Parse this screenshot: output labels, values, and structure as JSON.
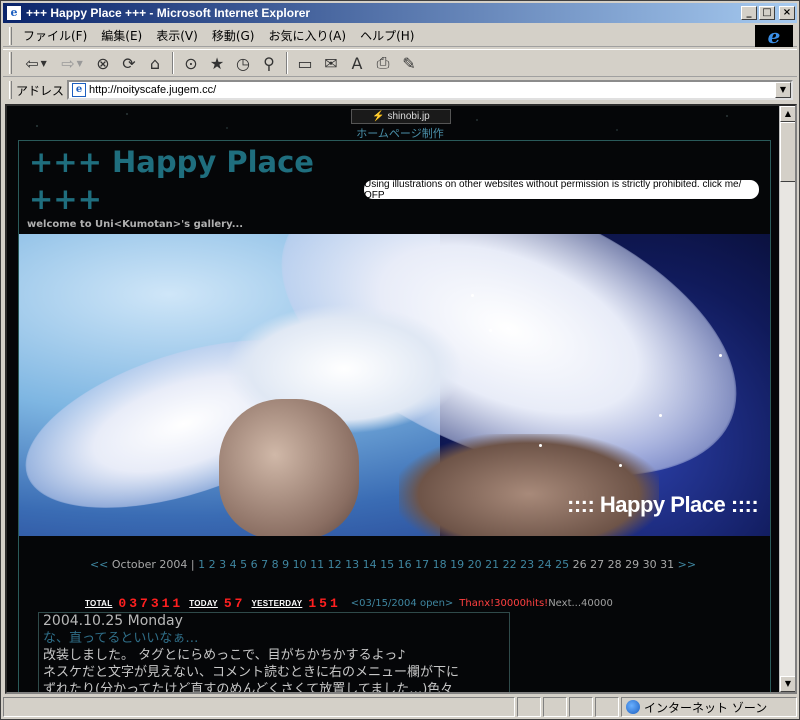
{
  "window": {
    "title": "+++ Happy Place +++ - Microsoft Internet Explorer",
    "app_icon": "e",
    "minimize_glyph": "_",
    "maximize_glyph": "□",
    "close_glyph": "×"
  },
  "menubar": {
    "items": [
      "ファイル(F)",
      "編集(E)",
      "表示(V)",
      "移動(G)",
      "お気に入り(A)",
      "ヘルプ(H)"
    ]
  },
  "ie_logo": "e",
  "toolbar": {
    "back_glyph": "⇦",
    "forward_glyph": "⇨",
    "dropdown_glyph": "▼",
    "stop_glyph": "⊗",
    "refresh_glyph": "⟳",
    "home_glyph": "⌂",
    "search_glyph": "⊙",
    "favorites_glyph": "★",
    "history_glyph": "◷",
    "channels_glyph": "⚲",
    "fullscreen_glyph": "▭",
    "mail_glyph": "✉",
    "font_glyph": "A",
    "print_glyph": "⎙",
    "edit_glyph": "✎"
  },
  "addressbar": {
    "label": "アドレス",
    "url": "http://noityscafe.jugem.cc/",
    "page_icon": "e",
    "dropdown_glyph": "▼"
  },
  "page": {
    "shinobi_badge": "⚡ shinobi.jp",
    "hp_seisaku": "ホームページ制作",
    "site_title": "+++ Happy Place +++",
    "welcome": "welcome to Uni<Kumotan>'s gallery...",
    "notice": "Using illustrations on other websites without permission is strictly prohibited. click me/ OFP",
    "banner_caption": ":::: Happy Place ::::",
    "calendar": {
      "prev": "<<",
      "month": "October 2004",
      "sep": "|",
      "days": [
        1,
        2,
        3,
        4,
        5,
        6,
        7,
        8,
        9,
        10,
        11,
        12,
        13,
        14,
        15,
        16,
        17,
        18,
        19,
        20,
        21,
        22,
        23,
        24,
        25,
        26,
        27,
        28,
        29,
        30,
        31
      ],
      "linked_until": 25,
      "next": ">>"
    },
    "counter": {
      "total_label": "TOTAL",
      "total_value": "037311",
      "today_label": "TODAY",
      "today_value": "57",
      "yesterday_label": "YESTERDAY",
      "yesterday_value": "151",
      "open_text": "<03/15/2004 open>",
      "thanx_text": "Thanx!30000hits!",
      "next_text": "Next...40000"
    },
    "entry": {
      "date": "2004.10.25 Monday",
      "subtitle": "な、直ってるといいなぁ…",
      "lines": [
        "改装しました。 タグとにらめっこで、目がちかちかするよっ♪",
        "ネスケだと文字が見えない、コメント読むときに右のメニュー欄が下に",
        "ずれたり(分かってたけど直すのめんどくさくて放置してました…)色々"
      ]
    }
  },
  "scrollbar": {
    "up_glyph": "▲",
    "down_glyph": "▼"
  },
  "statusbar": {
    "zone": "インターネット ゾーン"
  }
}
